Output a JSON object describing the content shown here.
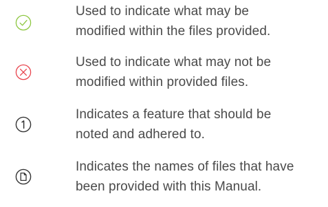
{
  "legend": {
    "rows": [
      {
        "icon": "check-circle-icon",
        "icon_color": "#8cc63f",
        "lines": [
          "Used to indicate what may be",
          "modified within the files provided."
        ]
      },
      {
        "icon": "cross-circle-icon",
        "icon_color": "#e8434c",
        "lines": [
          "Used to indicate what may not be",
          "modified within provided files."
        ]
      },
      {
        "icon": "number-one-circle-icon",
        "icon_color": "#333333",
        "lines": [
          "Indicates a feature that should be",
          "noted and adhered to."
        ]
      },
      {
        "icon": "document-circle-icon",
        "icon_color": "#333333",
        "lines": [
          "Indicates the names of files that have",
          "been provided with this Manual."
        ]
      }
    ]
  }
}
